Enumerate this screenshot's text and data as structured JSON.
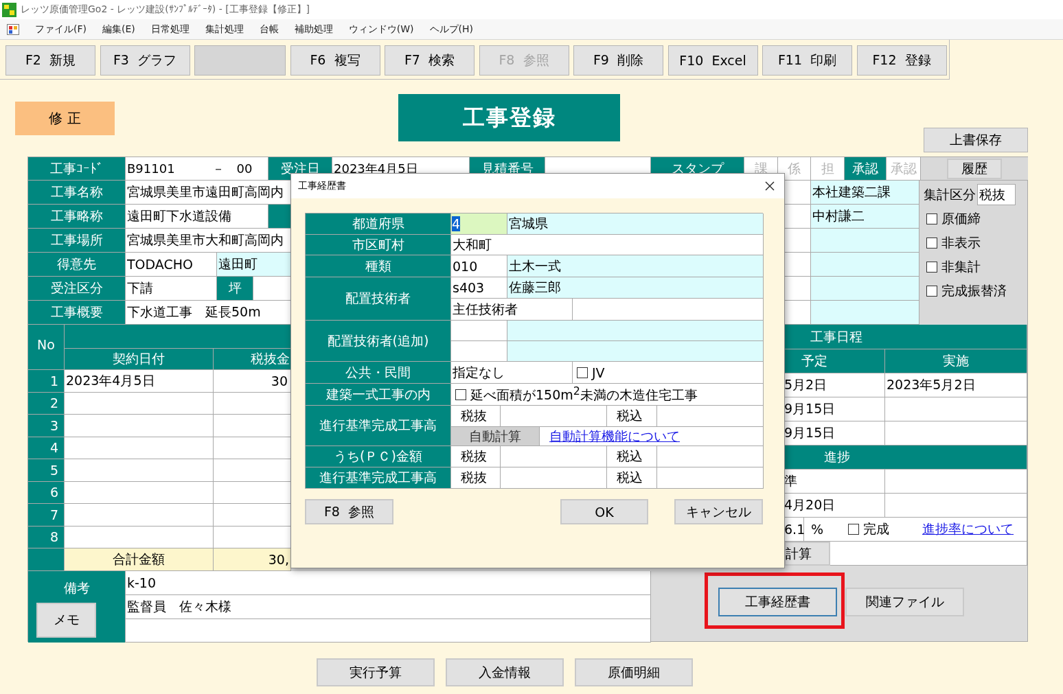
{
  "window": {
    "title": "レッツ原価管理Go2 - レッツ建設(ｻﾝﾌﾟﾙﾃﾞｰﾀ) - [工事登録【修正】]"
  },
  "menu": [
    "ファイル(F)",
    "編集(E)",
    "日常処理",
    "集計処理",
    "台帳",
    "補助処理",
    "ウィンドウ(W)",
    "ヘルプ(H)"
  ],
  "toolbar": [
    {
      "kind": "key",
      "label": "F2  新規",
      "disabled": false
    },
    {
      "kind": "key",
      "label": "F3  グラフ",
      "disabled": false
    },
    {
      "kind": "blank"
    },
    {
      "kind": "key",
      "label": "F6  複写",
      "disabled": false
    },
    {
      "kind": "key",
      "label": "F7  検索",
      "disabled": false
    },
    {
      "kind": "key",
      "label": "F8  参照",
      "disabled": true
    },
    {
      "kind": "key",
      "label": "F9  削除",
      "disabled": false
    },
    {
      "kind": "key",
      "label": "F10  Excel",
      "disabled": false
    },
    {
      "kind": "key",
      "label": "F11  印刷",
      "disabled": false
    },
    {
      "kind": "key",
      "label": "F12  登録",
      "disabled": false
    }
  ],
  "mode_badge": "修 正",
  "form_title": "工事登録",
  "save_button": "上書保存",
  "header_cells": [
    {
      "kind": "label",
      "text": "工事ｺｰﾄﾞ"
    },
    {
      "kind": "input",
      "text": "B91101　　　－　00"
    },
    {
      "kind": "label",
      "text": "受注日"
    },
    {
      "kind": "input",
      "text": "2023年4月5日"
    },
    {
      "kind": "label",
      "text": "見積番号"
    },
    {
      "kind": "input"
    },
    {
      "kind": "label",
      "text": "スタンプ"
    }
  ],
  "stamps": [
    {
      "label": "課",
      "on": false
    },
    {
      "label": "係",
      "on": false
    },
    {
      "label": "担",
      "on": false
    },
    {
      "label": "承認",
      "on": true
    },
    {
      "label": "承認",
      "on": false
    }
  ],
  "history_button": "履歴",
  "fields": [
    {
      "label": "工事名称",
      "cells": [
        {
          "kind": "input",
          "text": "宮城県美里市遠田町高岡内"
        }
      ]
    },
    {
      "label": "工事略称",
      "cells": [
        {
          "kind": "input",
          "text": "遠田町下水道設備"
        },
        {
          "kind": "label"
        }
      ]
    },
    {
      "label": "工事場所",
      "cells": [
        {
          "kind": "input",
          "text": "宮城県美里市大和町高岡内"
        }
      ]
    },
    {
      "label": "得意先",
      "cells": [
        {
          "kind": "input",
          "text": "TODACHO"
        },
        {
          "kind": "lookup",
          "text": "遠田町"
        }
      ]
    },
    {
      "label": "受注区分",
      "cells": [
        {
          "kind": "input",
          "text": "下請"
        },
        {
          "kind": "label",
          "text": "坪"
        },
        {
          "kind": "input"
        }
      ]
    },
    {
      "label": "工事概要",
      "cells": [
        {
          "kind": "input",
          "text": "下水道工事　延長50m"
        }
      ]
    }
  ],
  "side_values": [
    "本社建築二課",
    "中村謙二"
  ],
  "tally": {
    "label": "集計区分",
    "value": "税抜"
  },
  "flags": [
    {
      "label": "原価締",
      "checked": false
    },
    {
      "label": "非表示",
      "checked": false
    },
    {
      "label": "非集計",
      "checked": false
    },
    {
      "label": "完成振替済",
      "checked": false
    }
  ],
  "contracts": {
    "no_header": "No",
    "columns": [
      "契約日付",
      "税抜金"
    ],
    "rows": [
      {
        "no": "1",
        "date": "2023年4月5日",
        "amount": "30"
      },
      {
        "no": "2"
      },
      {
        "no": "3"
      },
      {
        "no": "4"
      },
      {
        "no": "5"
      },
      {
        "no": "6"
      },
      {
        "no": "7"
      },
      {
        "no": "8"
      }
    ],
    "total_label": "合計金額",
    "total": "30,"
  },
  "schedule": {
    "title": "工事日程",
    "columns": [
      "予定",
      "実施"
    ],
    "rows": [
      [
        "5月2日",
        "2023年5月2日"
      ],
      [
        "9月15日"
      ],
      [
        "9月15日"
      ]
    ]
  },
  "progress": {
    "title": "進捗",
    "rows": [
      [
        "準"
      ],
      [
        "4月20日"
      ]
    ],
    "rate": "6.1",
    "unit": "%",
    "complete": {
      "label": "完成",
      "checked": false
    },
    "link": "進捗率について",
    "calc_button": "計算"
  },
  "remarks": {
    "label": "備考",
    "memo_button": "メモ",
    "lines": [
      "k-10",
      "監督員　佐々木様"
    ]
  },
  "actions": [
    {
      "label": "工事経歴書",
      "highlighted": true
    },
    {
      "label": "関連ファイル",
      "highlighted": false
    }
  ],
  "bottom_buttons": [
    "実行予算",
    "入金情報",
    "原価明細"
  ],
  "dialog": {
    "title": "工事経歴書",
    "prefecture": {
      "label": "都道府県",
      "code": "4",
      "code_selected": true,
      "name": "宮城県"
    },
    "city": {
      "label": "市区町村",
      "value": "大和町"
    },
    "category": {
      "label": "種類",
      "code": "010",
      "name": "土木一式"
    },
    "engineer": {
      "label": "配置技術者",
      "code": "s403",
      "name": "佐藤三郎",
      "role": "主任技術者"
    },
    "extra_engineer": {
      "label": "配置技術者(追加)"
    },
    "sector": {
      "label": "公共・民間",
      "value": "指定なし",
      "jv": {
        "label": "JV",
        "checked": false
      }
    },
    "building": {
      "label": "建築一式工事の内",
      "option": {
        "label": "延べ面積が150m$^{2}$未満の木造住宅工事",
        "checked": false
      }
    },
    "amount_rows": [
      {
        "label": "進行基準完成工事高",
        "excl": "税抜",
        "incl": "税込",
        "auto": {
          "button": "自動計算",
          "link": "自動計算機能について"
        }
      },
      {
        "label": "うち(ＰＣ)金額",
        "excl": "税抜",
        "incl": "税込"
      },
      {
        "label": "進行基準完成工事高",
        "excl": "税抜",
        "incl": "税込"
      }
    ],
    "buttons": [
      {
        "kind": "reference",
        "label": "F8  参照"
      },
      {
        "kind": "ok",
        "label": "OK"
      },
      {
        "kind": "cancel",
        "label": "キャンセル"
      }
    ]
  }
}
